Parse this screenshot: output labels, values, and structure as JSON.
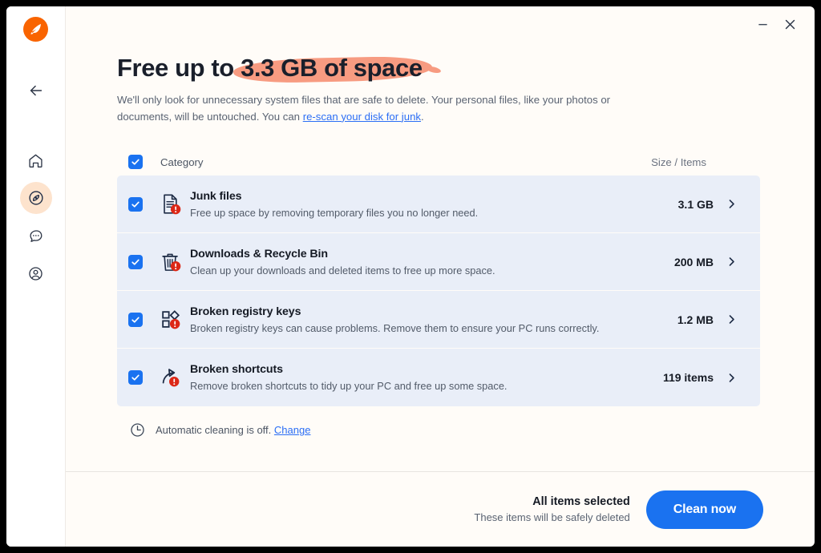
{
  "window": {
    "minimize_label": "Minimize",
    "close_label": "Close"
  },
  "sidebar": {
    "logo_name": "avast-cleanup-logo",
    "items": [
      {
        "icon": "back-arrow-icon",
        "label": "Back",
        "active": false
      },
      {
        "icon": "home-icon",
        "label": "Home",
        "active": false
      },
      {
        "icon": "compass-icon",
        "label": "Explore",
        "active": true
      },
      {
        "icon": "chat-icon",
        "label": "Support",
        "active": false
      },
      {
        "icon": "account-icon",
        "label": "Account",
        "active": false
      }
    ]
  },
  "header": {
    "headline_prefix": "Free up to ",
    "headline_highlight": "3.3 GB of space",
    "subtitle_part1": "We'll only look for unnecessary system files that are safe to delete. Your personal files, like your photos or documents, will be untouched. You can ",
    "subtitle_link": "re-scan your disk for junk",
    "subtitle_part2": "."
  },
  "table": {
    "header": {
      "category_label": "Category",
      "size_label": "Size / Items",
      "select_all_checked": true
    },
    "rows": [
      {
        "icon": "document-warning-icon",
        "title": "Junk files",
        "description": "Free up space by removing temporary files you no longer need.",
        "size": "3.1 GB",
        "checked": true
      },
      {
        "icon": "trash-warning-icon",
        "title": "Downloads & Recycle Bin",
        "description": "Clean up your downloads and deleted items to free up more space.",
        "size": "200 MB",
        "checked": true
      },
      {
        "icon": "registry-warning-icon",
        "title": "Broken registry keys",
        "description": "Broken registry keys can cause problems. Remove them to ensure your PC runs correctly.",
        "size": "1.2 MB",
        "checked": true
      },
      {
        "icon": "shortcut-warning-icon",
        "title": "Broken shortcuts",
        "description": "Remove broken shortcuts to tidy up your PC and free up some space.",
        "size": "119 items",
        "checked": true
      }
    ]
  },
  "autoclean": {
    "icon": "clock-icon",
    "text": "Automatic cleaning is off. ",
    "link": "Change"
  },
  "footer": {
    "status_title": "All items selected",
    "status_sub": "These items will be safely deleted",
    "button_label": "Clean now"
  },
  "colors": {
    "accent_blue": "#1a72f0",
    "brand_orange": "#f96400",
    "highlight_salmon": "#f79b81",
    "row_bg": "#e9eef8",
    "page_bg": "#fffcf8",
    "warning_red": "#dc2817"
  }
}
